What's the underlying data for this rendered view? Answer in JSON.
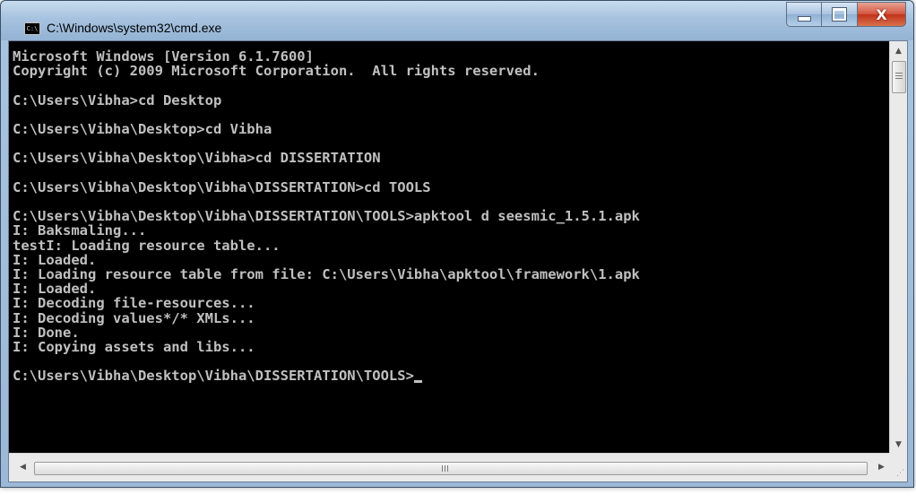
{
  "window": {
    "title": "C:\\Windows\\system32\\cmd.exe",
    "icon_text": "C:\\",
    "close_glyph": "X"
  },
  "console": {
    "lines": [
      "Microsoft Windows [Version 6.1.7600]",
      "Copyright (c) 2009 Microsoft Corporation.  All rights reserved.",
      "",
      "C:\\Users\\Vibha>cd Desktop",
      "",
      "C:\\Users\\Vibha\\Desktop>cd Vibha",
      "",
      "C:\\Users\\Vibha\\Desktop\\Vibha>cd DISSERTATION",
      "",
      "C:\\Users\\Vibha\\Desktop\\Vibha\\DISSERTATION>cd TOOLS",
      "",
      "C:\\Users\\Vibha\\Desktop\\Vibha\\DISSERTATION\\TOOLS>apktool d seesmic_1.5.1.apk",
      "I: Baksmaling...",
      "testI: Loading resource table...",
      "I: Loaded.",
      "I: Loading resource table from file: C:\\Users\\Vibha\\apktool\\framework\\1.apk",
      "I: Loaded.",
      "I: Decoding file-resources...",
      "I: Decoding values*/* XMLs...",
      "I: Done.",
      "I: Copying assets and libs...",
      "",
      "C:\\Users\\Vibha\\Desktop\\Vibha\\DISSERTATION\\TOOLS>"
    ]
  },
  "icons": {
    "app": "console-icon",
    "minimize": "minimize-icon",
    "maximize": "maximize-icon",
    "close": "close-icon",
    "scroll_up": "chevron-up-icon",
    "scroll_down": "chevron-down-icon",
    "scroll_left": "chevron-left-icon",
    "scroll_right": "chevron-right-icon"
  },
  "colors": {
    "console_bg": "#000000",
    "console_fg": "#c0c0c0",
    "close_button": "#c1331a"
  }
}
